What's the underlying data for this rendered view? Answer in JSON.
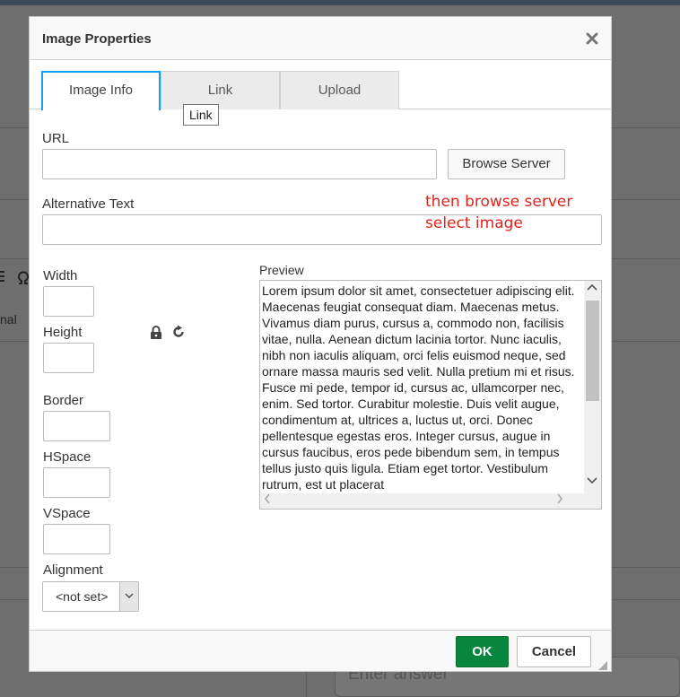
{
  "background": {
    "fragment_text": "nal",
    "answer_placeholder": "Enter answer"
  },
  "dialog": {
    "title": "Image Properties",
    "close_glyph": "✕",
    "tabs": [
      {
        "label": "Image Info",
        "active": true
      },
      {
        "label": "Link",
        "active": false
      },
      {
        "label": "Upload",
        "active": false
      }
    ],
    "tooltip": "Link",
    "url": {
      "label": "URL",
      "value": ""
    },
    "browse_server_label": "Browse Server",
    "alt_text": {
      "label": "Alternative Text",
      "value": ""
    },
    "annotation": {
      "line1": "then browse server",
      "line2": "select image",
      "color": "#e0241b"
    },
    "fields": {
      "width": {
        "label": "Width",
        "value": ""
      },
      "height": {
        "label": "Height",
        "value": ""
      },
      "border": {
        "label": "Border",
        "value": ""
      },
      "hspace": {
        "label": "HSpace",
        "value": ""
      },
      "vspace": {
        "label": "VSpace",
        "value": ""
      }
    },
    "alignment": {
      "label": "Alignment",
      "selected": "<not set>"
    },
    "preview": {
      "label": "Preview",
      "text": "Lorem ipsum dolor sit amet, consectetuer adipiscing elit. Maecenas feugiat consequat diam. Maecenas metus. Vivamus diam purus, cursus a, commodo non, facilisis vitae, nulla. Aenean dictum lacinia tortor. Nunc iaculis, nibh non iaculis aliquam, orci felis euismod neque, sed ornare massa mauris sed velit. Nulla pretium mi et risus. Fusce mi pede, tempor id, cursus ac, ullamcorper nec, enim. Sed tortor. Curabitur molestie. Duis velit augue, condimentum at, ultrices a, luctus ut, orci. Donec pellentesque egestas eros. Integer cursus, augue in cursus faucibus, eros pede bibendum sem, in tempus tellus justo quis ligula. Etiam eget tortor. Vestibulum rutrum, est ut placerat"
    },
    "ok_label": "OK",
    "cancel_label": "Cancel",
    "colors": {
      "accent": "#139ff7",
      "ok": "#09863e"
    },
    "icons": [
      "close-icon",
      "lock-icon",
      "reset-size-icon",
      "chevron-down-icon",
      "resize-handle-icon"
    ]
  }
}
